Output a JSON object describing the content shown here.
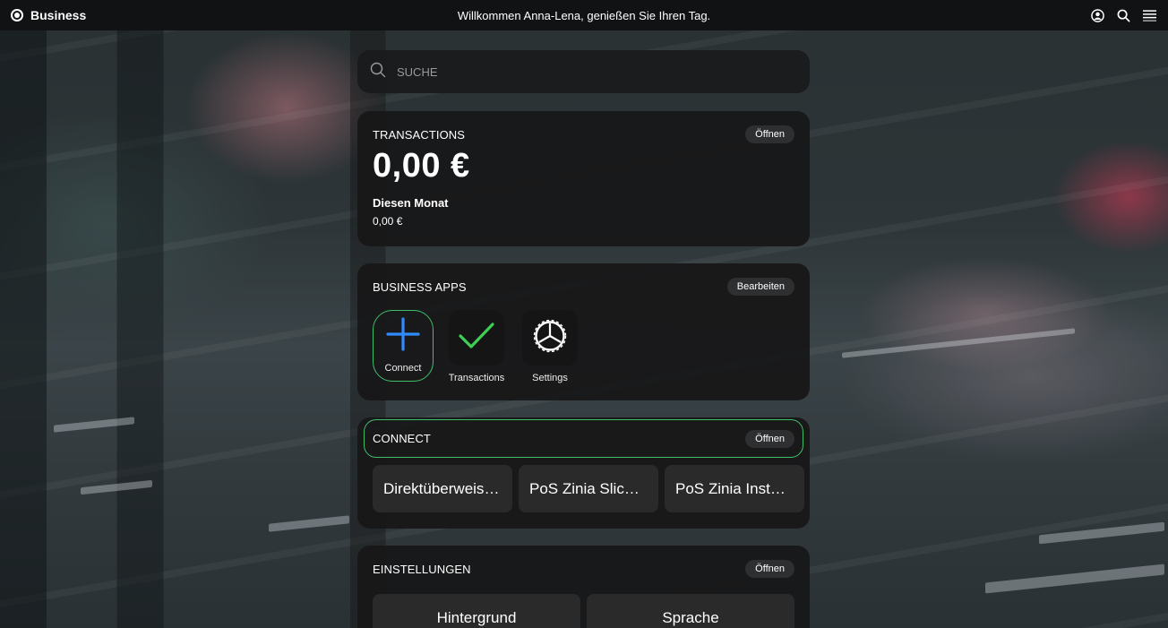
{
  "topbar": {
    "brand": "Business",
    "welcome": "Willkommen Anna-Lena, genießen Sie Ihren Tag."
  },
  "search": {
    "placeholder": "SUCHE"
  },
  "transactions": {
    "title": "TRANSACTIONS",
    "action": "Öffnen",
    "total": "0,00 €",
    "month_label": "Diesen Monat",
    "month_value": "0,00 €"
  },
  "business_apps": {
    "title": "BUSINESS APPS",
    "action": "Bearbeiten",
    "apps": [
      {
        "label": "Connect",
        "icon": "plus-icon",
        "color": "#2f8bff",
        "selected": true
      },
      {
        "label": "Transactions",
        "icon": "checkmark-icon",
        "color": "#3fcf55"
      },
      {
        "label": "Settings",
        "icon": "settings-gear-icon",
        "color": "#ffffff"
      }
    ]
  },
  "connect": {
    "title": "CONNECT",
    "action": "Öffnen",
    "items": [
      "Direktüberweisu...",
      "PoS Zinia Slice-i...",
      "PoS Zinia Install..."
    ]
  },
  "settings": {
    "title": "EINSTELLUNGEN",
    "action": "Öffnen",
    "items": [
      "Hintergrund",
      "Sprache"
    ]
  },
  "colors": {
    "accent_green": "#3fbf6a",
    "topbar": "#111213",
    "card": "#181819"
  }
}
